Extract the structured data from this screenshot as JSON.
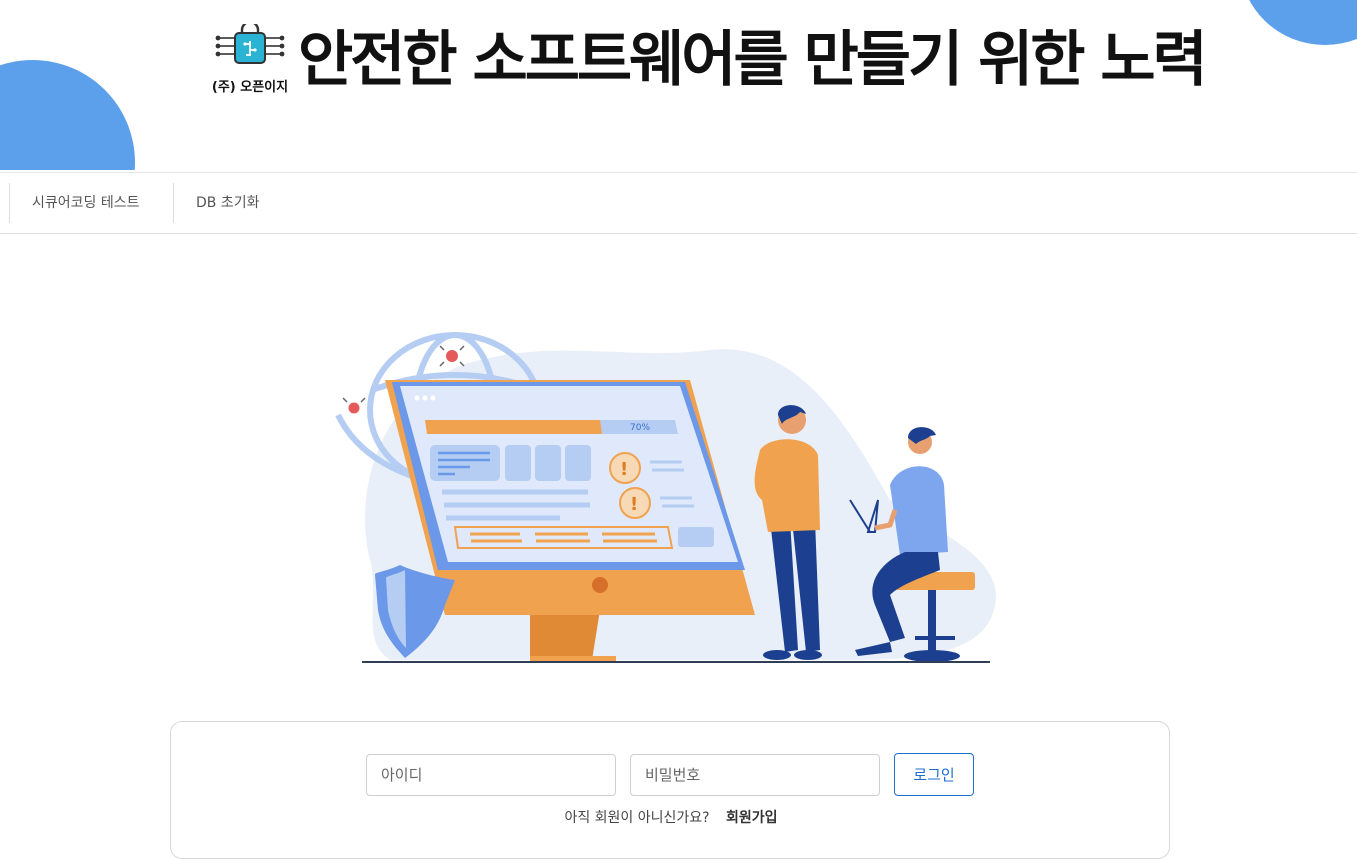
{
  "header": {
    "company_name": "(주) 오픈이지",
    "title": "안전한 소프트웨어를 만들기 위한 노력"
  },
  "nav": {
    "items": [
      {
        "label": "시큐어코딩 테스트"
      },
      {
        "label": "DB 초기화"
      }
    ]
  },
  "illustration": {
    "progress_label": "70%",
    "progress_fraction": 0.7
  },
  "login": {
    "username_placeholder": "아이디",
    "password_placeholder": "비밀번호",
    "button_label": "로그인",
    "signup_prompt": "아직 회원이 아니신가요?",
    "signup_link": "회원가입"
  },
  "colors": {
    "accent": "#1f6fd1",
    "blob": "#5ca0ec",
    "illustration_orange": "#f0a24e",
    "illustration_blue": "#6b98e8"
  },
  "icons": [
    "lock-circuit-icon",
    "shield-icon",
    "bug-icon",
    "warning-icon"
  ]
}
